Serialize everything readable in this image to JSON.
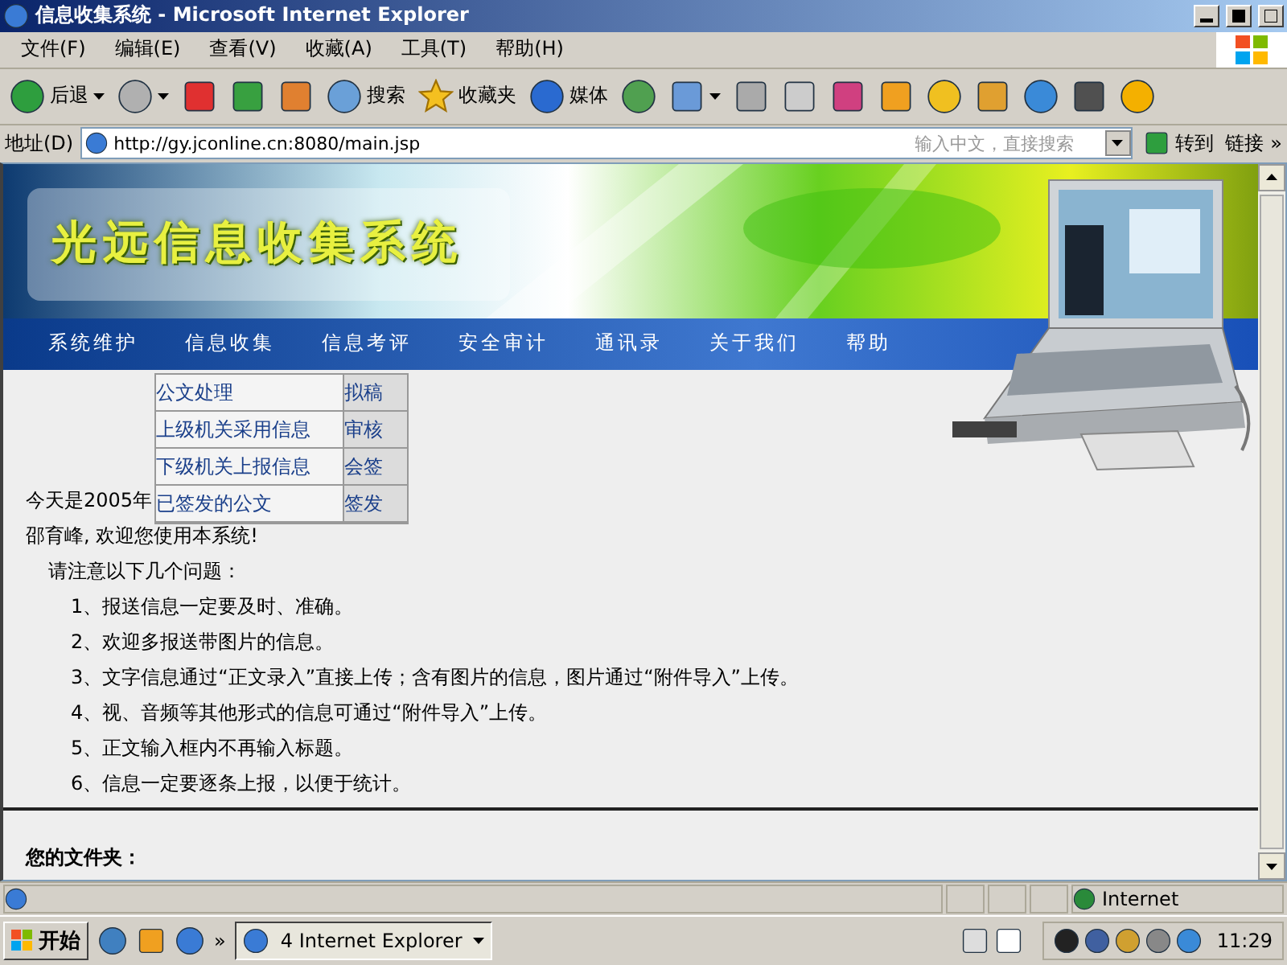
{
  "window": {
    "title": "信息收集系统 - Microsoft Internet Explorer"
  },
  "menu": [
    "文件(F)",
    "编辑(E)",
    "查看(V)",
    "收藏(A)",
    "工具(T)",
    "帮助(H)"
  ],
  "toolbar": [
    {
      "label": "后退",
      "dropdown": true
    },
    {
      "dropdown": true
    },
    {
      "dropdown": false
    },
    {
      "dropdown": false
    },
    {
      "dropdown": false
    },
    {
      "label": "搜索",
      "dropdown": false
    },
    {
      "label": "收藏夹",
      "dropdown": false
    },
    {
      "label": "媒体",
      "dropdown": false
    },
    {
      "dropdown": false
    },
    {
      "dropdown": true
    },
    {
      "dropdown": false
    },
    {
      "dropdown": false
    },
    {
      "dropdown": false
    },
    {
      "dropdown": false
    },
    {
      "dropdown": false
    },
    {
      "dropdown": false
    },
    {
      "dropdown": false
    },
    {
      "dropdown": false
    },
    {
      "dropdown": false
    }
  ],
  "address": {
    "label": "地址(D)",
    "url": "http://gy.jconline.cn:8080/main.jsp",
    "search_placeholder": "输入中文，直接搜索",
    "go": "转到",
    "links": "链接",
    "more": "»"
  },
  "page": {
    "site_title": "光远信息收集系统",
    "nav": [
      "系统维护",
      "信息收集",
      "信息考评",
      "安全审计",
      "通讯录",
      "关于我们",
      "帮助"
    ],
    "dropdown": [
      {
        "label": "公文处理",
        "action": "拟稿"
      },
      {
        "label": "上级机关采用信息",
        "action": "审核"
      },
      {
        "label": "下级机关上报信息",
        "action": "会签"
      },
      {
        "label": "已签发的公文",
        "action": "签发"
      }
    ],
    "date_text": "今天是2005年",
    "welcome": "邵育峰, 欢迎您使用本系统!",
    "notice_title": "请注意以下几个问题：",
    "notices": [
      "1、报送信息一定要及时、准确。",
      "2、欢迎多报送带图片的信息。",
      "3、文字信息通过“正文录入”直接上传；含有图片的信息，图片通过“附件导入”上传。",
      "4、视、音频等其他形式的信息可通过“附件导入”上传。",
      "5、正文输入框内不再输入标题。",
      "6、信息一定要逐条上报，以便于统计。"
    ],
    "folder_title": "您的文件夹："
  },
  "status_bar": {
    "zone": "Internet"
  },
  "taskbar": {
    "start": "开始",
    "more": "»",
    "task": "4 Internet Explorer",
    "clock": "11:29"
  }
}
